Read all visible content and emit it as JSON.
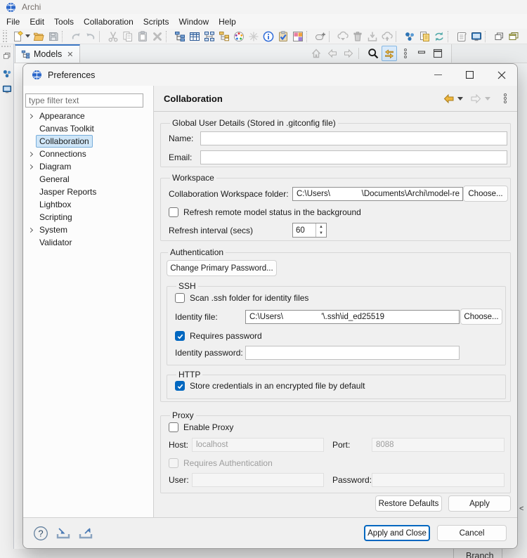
{
  "window": {
    "title": "Archi"
  },
  "menubar": {
    "items": [
      "File",
      "Edit",
      "Tools",
      "Collaboration",
      "Scripts",
      "Window",
      "Help"
    ]
  },
  "toolbar": {
    "items": [
      {
        "kind": "handle"
      },
      {
        "kind": "icon",
        "name": "new-model"
      },
      {
        "kind": "dd"
      },
      {
        "kind": "icon",
        "name": "open-model"
      },
      {
        "kind": "icon",
        "name": "save-model"
      },
      {
        "kind": "sep-dots"
      },
      {
        "kind": "icon",
        "name": "undo"
      },
      {
        "kind": "icon",
        "name": "redo"
      },
      {
        "kind": "sep-line"
      },
      {
        "kind": "icon",
        "name": "cut"
      },
      {
        "kind": "icon",
        "name": "copy"
      },
      {
        "kind": "icon",
        "name": "paste"
      },
      {
        "kind": "icon",
        "name": "delete"
      },
      {
        "kind": "sep-dots"
      },
      {
        "kind": "icon",
        "name": "model-tree"
      },
      {
        "kind": "icon",
        "name": "table-view"
      },
      {
        "kind": "icon",
        "name": "diagram-layout"
      },
      {
        "kind": "icon",
        "name": "navigator-tree"
      },
      {
        "kind": "icon",
        "name": "color-wheel"
      },
      {
        "kind": "icon",
        "name": "sketch"
      },
      {
        "kind": "icon",
        "name": "info"
      },
      {
        "kind": "icon",
        "name": "validate"
      },
      {
        "kind": "icon",
        "name": "color-grid"
      },
      {
        "kind": "sep-dots"
      },
      {
        "kind": "icon",
        "name": "rename"
      },
      {
        "kind": "sep-line"
      },
      {
        "kind": "icon",
        "name": "revert-cloud"
      },
      {
        "kind": "icon",
        "name": "trash"
      },
      {
        "kind": "icon",
        "name": "import-model"
      },
      {
        "kind": "icon",
        "name": "publish-cloud"
      },
      {
        "kind": "sep-line"
      },
      {
        "kind": "icon",
        "name": "collab-molecule"
      },
      {
        "kind": "icon",
        "name": "model-report"
      },
      {
        "kind": "icon",
        "name": "sync-teal"
      },
      {
        "kind": "sep-dots"
      },
      {
        "kind": "icon",
        "name": "script"
      },
      {
        "kind": "icon",
        "name": "console"
      },
      {
        "kind": "sep-dots"
      },
      {
        "kind": "icon",
        "name": "restore-window"
      },
      {
        "kind": "icon",
        "name": "cascade-windows"
      }
    ]
  },
  "models_panel": {
    "tab_label": "Models",
    "toolbar": [
      {
        "kind": "icon",
        "name": "home"
      },
      {
        "kind": "icon",
        "name": "nav-back"
      },
      {
        "kind": "icon",
        "name": "nav-forward"
      },
      {
        "kind": "sep-line"
      },
      {
        "kind": "icon",
        "name": "search"
      },
      {
        "kind": "icon",
        "name": "sync-gold",
        "boxed": true
      },
      {
        "kind": "icon",
        "name": "view-menu"
      },
      {
        "kind": "icon",
        "name": "minimize-view"
      },
      {
        "kind": "icon",
        "name": "maximize-view"
      }
    ]
  },
  "sidebar": {
    "icons": [
      "restore-window",
      "collab-molecule",
      "console"
    ]
  },
  "background": {
    "branch_label": "Branch",
    "collapse_chevron": "<"
  },
  "dialog": {
    "title": "Preferences",
    "filter_placeholder": "type filter text",
    "tree": {
      "items": [
        {
          "label": "Appearance",
          "expandable": true
        },
        {
          "label": "Canvas Toolkit",
          "expandable": false
        },
        {
          "label": "Collaboration",
          "expandable": false,
          "selected": true
        },
        {
          "label": "Connections",
          "expandable": true
        },
        {
          "label": "Diagram",
          "expandable": true
        },
        {
          "label": "General",
          "expandable": false
        },
        {
          "label": "Jasper Reports",
          "expandable": false
        },
        {
          "label": "Lightbox",
          "expandable": false
        },
        {
          "label": "Scripting",
          "expandable": false
        },
        {
          "label": "System",
          "expandable": true
        },
        {
          "label": "Validator",
          "expandable": false
        }
      ]
    },
    "page": {
      "title": "Collaboration",
      "global_user": {
        "label": "Global User Details (Stored in .gitconfig file)",
        "name_label": "Name:",
        "name_value": "",
        "email_label": "Email:",
        "email_value": ""
      },
      "workspace": {
        "label": "Workspace",
        "folder_label": "Collaboration Workspace folder:",
        "folder_value": "C:\\Users\\              \\Documents\\Archi\\model-re",
        "choose_label": "Choose...",
        "refresh_checkbox": "Refresh remote model status in the background",
        "refresh_checked": false,
        "interval_label": "Refresh interval (secs)",
        "interval_value": "60"
      },
      "auth": {
        "label": "Authentication",
        "change_pw_label": "Change Primary Password...",
        "ssh": {
          "label": "SSH",
          "scan_checkbox": "Scan .ssh folder for identity files",
          "scan_checked": false,
          "identity_file_label": "Identity file:",
          "identity_file_value": "C:\\Users\\                 '\\.ssh\\id_ed25519",
          "choose_label": "Choose...",
          "requires_pw_checkbox": "Requires password",
          "requires_pw_checked": true,
          "identity_pw_label": "Identity password:",
          "identity_pw_value": ""
        },
        "http": {
          "label": "HTTP",
          "store_checkbox": "Store credentials in an encrypted file by default",
          "store_checked": true
        }
      },
      "proxy": {
        "label": "Proxy",
        "enable_checkbox": "Enable Proxy",
        "enable_checked": false,
        "host_label": "Host:",
        "host_value": "localhost",
        "port_label": "Port:",
        "port_value": "8088",
        "requires_auth_checkbox": "Requires Authentication",
        "requires_auth_checked": false,
        "user_label": "User:",
        "user_value": "",
        "password_label": "Password:",
        "password_value": ""
      },
      "buttons": {
        "restore_defaults": "Restore Defaults",
        "apply": "Apply"
      }
    },
    "footer": {
      "apply_and_close": "Apply and Close",
      "cancel": "Cancel"
    }
  },
  "colors": {
    "accent": "#0067c0",
    "tab_accent": "#3a76c4",
    "selection_bg": "#cfe6f8"
  }
}
